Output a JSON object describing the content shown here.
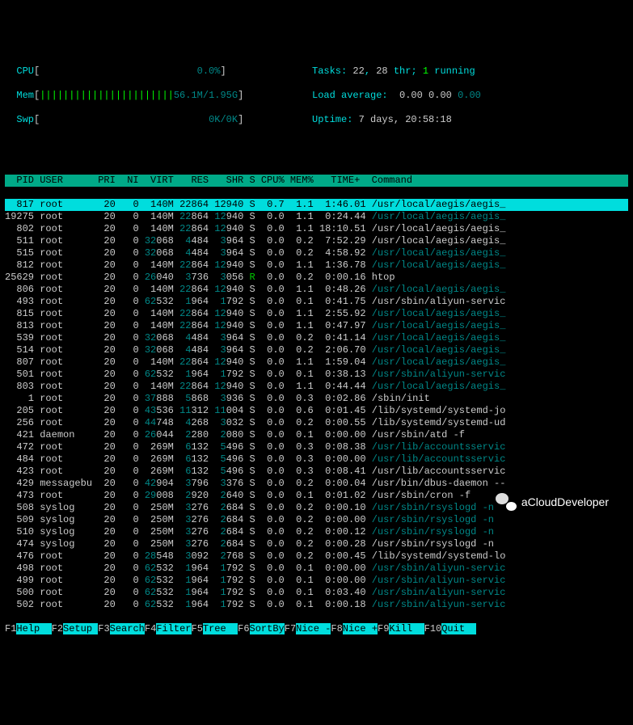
{
  "meters": {
    "cpu": {
      "label": "CPU",
      "bar": "[",
      "fill": "",
      "pad": "                           ",
      "val": "0.0%",
      "end": "]"
    },
    "mem": {
      "label": "Mem",
      "bar": "[",
      "fill": "|||||||||||||||||||||||",
      "val": "56.1M/1.95G",
      "end": "]"
    },
    "swp": {
      "label": "Swp",
      "bar": "[",
      "fill": "",
      "pad": "                             ",
      "val": "0K/0K",
      "end": "]"
    }
  },
  "summary": {
    "tasks_label": "Tasks: ",
    "tasks_total": "22",
    "tasks_sep": ", ",
    "tasks_thr": "28",
    "thr_label": " thr; ",
    "running": "1",
    "running_label": " running",
    "load_label": "Load average: ",
    "load1": "0.00",
    "load5": "0.00",
    "load15": "0.00",
    "uptime_label": "Uptime: ",
    "uptime": "7 days, 20:58:18"
  },
  "columns": "  PID USER      PRI  NI  VIRT   RES   SHR S CPU% MEM%   TIME+  Command",
  "processes": [
    {
      "pid": "817",
      "user": "root",
      "pri": "20",
      "ni": "0",
      "virt": "140M",
      "res": "22864",
      "shr": "12940",
      "s": "S",
      "cpu": "0.7",
      "mem": "1.1",
      "time": "1:46.01",
      "cmd": "/usr/local/aegis/aegis_",
      "sel": true
    },
    {
      "pid": "19275",
      "user": "root",
      "pri": "20",
      "ni": "0",
      "virt": "140M",
      "res": "22864",
      "shr": "12940",
      "s": "S",
      "cpu": "0.0",
      "mem": "1.1",
      "time": "0:24.44",
      "cmd": "/usr/local/aegis/aegis_",
      "dim": true
    },
    {
      "pid": "802",
      "user": "root",
      "pri": "20",
      "ni": "0",
      "virt": "140M",
      "res": "22864",
      "shr": "12940",
      "s": "S",
      "cpu": "0.0",
      "mem": "1.1",
      "time": "18:10.51",
      "cmd": "/usr/local/aegis/aegis_"
    },
    {
      "pid": "511",
      "user": "root",
      "pri": "20",
      "ni": "0",
      "virt": "32068",
      "res": "4484",
      "shr": "3964",
      "s": "S",
      "cpu": "0.0",
      "mem": "0.2",
      "time": "7:52.29",
      "cmd": "/usr/local/aegis/aegis_"
    },
    {
      "pid": "515",
      "user": "root",
      "pri": "20",
      "ni": "0",
      "virt": "32068",
      "res": "4484",
      "shr": "3964",
      "s": "S",
      "cpu": "0.0",
      "mem": "0.2",
      "time": "4:58.92",
      "cmd": "/usr/local/aegis/aegis_",
      "dim": true
    },
    {
      "pid": "812",
      "user": "root",
      "pri": "20",
      "ni": "0",
      "virt": "140M",
      "res": "22864",
      "shr": "12940",
      "s": "S",
      "cpu": "0.0",
      "mem": "1.1",
      "time": "1:36.78",
      "cmd": "/usr/local/aegis/aegis_",
      "dim": true
    },
    {
      "pid": "25629",
      "user": "root",
      "pri": "20",
      "ni": "0",
      "virt": "26040",
      "res": "3736",
      "shr": "3056",
      "s": "R",
      "cpu": "0.0",
      "mem": "0.2",
      "time": "0:00.16",
      "cmd": "htop",
      "running": true
    },
    {
      "pid": "806",
      "user": "root",
      "pri": "20",
      "ni": "0",
      "virt": "140M",
      "res": "22864",
      "shr": "12940",
      "s": "S",
      "cpu": "0.0",
      "mem": "1.1",
      "time": "0:48.26",
      "cmd": "/usr/local/aegis/aegis_",
      "dim": true
    },
    {
      "pid": "493",
      "user": "root",
      "pri": "20",
      "ni": "0",
      "virt": "62532",
      "res": "1964",
      "shr": "1792",
      "s": "S",
      "cpu": "0.0",
      "mem": "0.1",
      "time": "0:41.75",
      "cmd": "/usr/sbin/aliyun-servic"
    },
    {
      "pid": "815",
      "user": "root",
      "pri": "20",
      "ni": "0",
      "virt": "140M",
      "res": "22864",
      "shr": "12940",
      "s": "S",
      "cpu": "0.0",
      "mem": "1.1",
      "time": "2:55.92",
      "cmd": "/usr/local/aegis/aegis_",
      "dim": true
    },
    {
      "pid": "813",
      "user": "root",
      "pri": "20",
      "ni": "0",
      "virt": "140M",
      "res": "22864",
      "shr": "12940",
      "s": "S",
      "cpu": "0.0",
      "mem": "1.1",
      "time": "0:47.97",
      "cmd": "/usr/local/aegis/aegis_",
      "dim": true
    },
    {
      "pid": "539",
      "user": "root",
      "pri": "20",
      "ni": "0",
      "virt": "32068",
      "res": "4484",
      "shr": "3964",
      "s": "S",
      "cpu": "0.0",
      "mem": "0.2",
      "time": "0:41.14",
      "cmd": "/usr/local/aegis/aegis_",
      "dim": true
    },
    {
      "pid": "514",
      "user": "root",
      "pri": "20",
      "ni": "0",
      "virt": "32068",
      "res": "4484",
      "shr": "3964",
      "s": "S",
      "cpu": "0.0",
      "mem": "0.2",
      "time": "2:06.70",
      "cmd": "/usr/local/aegis/aegis_",
      "dim": true
    },
    {
      "pid": "807",
      "user": "root",
      "pri": "20",
      "ni": "0",
      "virt": "140M",
      "res": "22864",
      "shr": "12940",
      "s": "S",
      "cpu": "0.0",
      "mem": "1.1",
      "time": "1:59.04",
      "cmd": "/usr/local/aegis/aegis_",
      "dim": true
    },
    {
      "pid": "501",
      "user": "root",
      "pri": "20",
      "ni": "0",
      "virt": "62532",
      "res": "1964",
      "shr": "1792",
      "s": "S",
      "cpu": "0.0",
      "mem": "0.1",
      "time": "0:38.13",
      "cmd": "/usr/sbin/aliyun-servic",
      "dim": true
    },
    {
      "pid": "803",
      "user": "root",
      "pri": "20",
      "ni": "0",
      "virt": "140M",
      "res": "22864",
      "shr": "12940",
      "s": "S",
      "cpu": "0.0",
      "mem": "1.1",
      "time": "0:44.44",
      "cmd": "/usr/local/aegis/aegis_",
      "dim": true
    },
    {
      "pid": "1",
      "user": "root",
      "pri": "20",
      "ni": "0",
      "virt": "37888",
      "res": "5868",
      "shr": "3936",
      "s": "S",
      "cpu": "0.0",
      "mem": "0.3",
      "time": "0:02.86",
      "cmd": "/sbin/init"
    },
    {
      "pid": "205",
      "user": "root",
      "pri": "20",
      "ni": "0",
      "virt": "43536",
      "res": "11312",
      "shr": "11004",
      "s": "S",
      "cpu": "0.0",
      "mem": "0.6",
      "time": "0:01.45",
      "cmd": "/lib/systemd/systemd-jo"
    },
    {
      "pid": "256",
      "user": "root",
      "pri": "20",
      "ni": "0",
      "virt": "44748",
      "res": "4268",
      "shr": "3032",
      "s": "S",
      "cpu": "0.0",
      "mem": "0.2",
      "time": "0:00.55",
      "cmd": "/lib/systemd/systemd-ud"
    },
    {
      "pid": "421",
      "user": "daemon",
      "pri": "20",
      "ni": "0",
      "virt": "26044",
      "res": "2280",
      "shr": "2080",
      "s": "S",
      "cpu": "0.0",
      "mem": "0.1",
      "time": "0:00.00",
      "cmd": "/usr/sbin/atd -f"
    },
    {
      "pid": "472",
      "user": "root",
      "pri": "20",
      "ni": "0",
      "virt": "269M",
      "res": "6132",
      "shr": "5496",
      "s": "S",
      "cpu": "0.0",
      "mem": "0.3",
      "time": "0:08.38",
      "cmd": "/usr/lib/accountsservic",
      "dim": true
    },
    {
      "pid": "484",
      "user": "root",
      "pri": "20",
      "ni": "0",
      "virt": "269M",
      "res": "6132",
      "shr": "5496",
      "s": "S",
      "cpu": "0.0",
      "mem": "0.3",
      "time": "0:00.00",
      "cmd": "/usr/lib/accountsservic",
      "dim": true
    },
    {
      "pid": "423",
      "user": "root",
      "pri": "20",
      "ni": "0",
      "virt": "269M",
      "res": "6132",
      "shr": "5496",
      "s": "S",
      "cpu": "0.0",
      "mem": "0.3",
      "time": "0:08.41",
      "cmd": "/usr/lib/accountsservic"
    },
    {
      "pid": "429",
      "user": "messagebu",
      "pri": "20",
      "ni": "0",
      "virt": "42904",
      "res": "3796",
      "shr": "3376",
      "s": "S",
      "cpu": "0.0",
      "mem": "0.2",
      "time": "0:00.04",
      "cmd": "/usr/bin/dbus-daemon --"
    },
    {
      "pid": "473",
      "user": "root",
      "pri": "20",
      "ni": "0",
      "virt": "29008",
      "res": "2920",
      "shr": "2640",
      "s": "S",
      "cpu": "0.0",
      "mem": "0.1",
      "time": "0:01.02",
      "cmd": "/usr/sbin/cron -f"
    },
    {
      "pid": "508",
      "user": "syslog",
      "pri": "20",
      "ni": "0",
      "virt": "250M",
      "res": "3276",
      "shr": "2684",
      "s": "S",
      "cpu": "0.0",
      "mem": "0.2",
      "time": "0:00.10",
      "cmd": "/usr/sbin/rsyslogd -n",
      "dim": true
    },
    {
      "pid": "509",
      "user": "syslog",
      "pri": "20",
      "ni": "0",
      "virt": "250M",
      "res": "3276",
      "shr": "2684",
      "s": "S",
      "cpu": "0.0",
      "mem": "0.2",
      "time": "0:00.00",
      "cmd": "/usr/sbin/rsyslogd -n",
      "dim": true
    },
    {
      "pid": "510",
      "user": "syslog",
      "pri": "20",
      "ni": "0",
      "virt": "250M",
      "res": "3276",
      "shr": "2684",
      "s": "S",
      "cpu": "0.0",
      "mem": "0.2",
      "time": "0:00.12",
      "cmd": "/usr/sbin/rsyslogd -n",
      "dim": true
    },
    {
      "pid": "474",
      "user": "syslog",
      "pri": "20",
      "ni": "0",
      "virt": "250M",
      "res": "3276",
      "shr": "2684",
      "s": "S",
      "cpu": "0.0",
      "mem": "0.2",
      "time": "0:00.28",
      "cmd": "/usr/sbin/rsyslogd -n"
    },
    {
      "pid": "476",
      "user": "root",
      "pri": "20",
      "ni": "0",
      "virt": "28548",
      "res": "3092",
      "shr": "2768",
      "s": "S",
      "cpu": "0.0",
      "mem": "0.2",
      "time": "0:00.45",
      "cmd": "/lib/systemd/systemd-lo"
    },
    {
      "pid": "498",
      "user": "root",
      "pri": "20",
      "ni": "0",
      "virt": "62532",
      "res": "1964",
      "shr": "1792",
      "s": "S",
      "cpu": "0.0",
      "mem": "0.1",
      "time": "0:00.00",
      "cmd": "/usr/sbin/aliyun-servic",
      "dim": true
    },
    {
      "pid": "499",
      "user": "root",
      "pri": "20",
      "ni": "0",
      "virt": "62532",
      "res": "1964",
      "shr": "1792",
      "s": "S",
      "cpu": "0.0",
      "mem": "0.1",
      "time": "0:00.00",
      "cmd": "/usr/sbin/aliyun-servic",
      "dim": true
    },
    {
      "pid": "500",
      "user": "root",
      "pri": "20",
      "ni": "0",
      "virt": "62532",
      "res": "1964",
      "shr": "1792",
      "s": "S",
      "cpu": "0.0",
      "mem": "0.1",
      "time": "0:03.40",
      "cmd": "/usr/sbin/aliyun-servic",
      "dim": true
    },
    {
      "pid": "502",
      "user": "root",
      "pri": "20",
      "ni": "0",
      "virt": "62532",
      "res": "1964",
      "shr": "1792",
      "s": "S",
      "cpu": "0.0",
      "mem": "0.1",
      "time": "0:00.18",
      "cmd": "/usr/sbin/aliyun-servic",
      "dim": true
    }
  ],
  "fkeys": [
    [
      "F1",
      "Help  "
    ],
    [
      "F2",
      "Setup "
    ],
    [
      "F3",
      "Search"
    ],
    [
      "F4",
      "Filter"
    ],
    [
      "F5",
      "Tree  "
    ],
    [
      "F6",
      "SortBy"
    ],
    [
      "F7",
      "Nice -"
    ],
    [
      "F8",
      "Nice +"
    ],
    [
      "F9",
      "Kill  "
    ],
    [
      "F10",
      "Quit  "
    ]
  ],
  "watermark": "aCloudDeveloper"
}
